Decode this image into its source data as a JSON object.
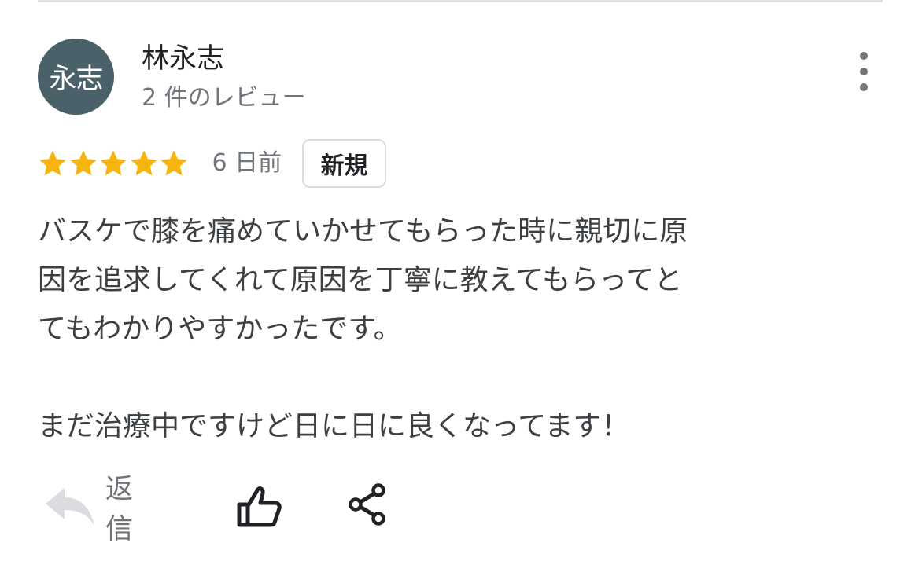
{
  "review": {
    "avatar_text": "永志",
    "reviewer_name": "林永志",
    "review_count": "2 件のレビュー",
    "rating": 5,
    "rating_max": 5,
    "age": "6 日前",
    "badge": "新規",
    "text": "バスケで膝を痛めていかせてもらった時に親切に原\n因を追求してくれて原因を丁寧に教えてもらってと\nてもわかりやすかったです。\n\nまだ治療中ですけど日に日に良くなってます！"
  },
  "actions": {
    "reply_label": "返信"
  },
  "icons": {
    "more": "more-vertical-icon",
    "star": "star-icon",
    "reply": "reply-arrow-icon",
    "like": "thumbs-up-icon",
    "share": "share-icon"
  },
  "colors": {
    "avatar_bg": "#4a6169",
    "star": "#f5b50e",
    "secondary_text": "#70757a",
    "primary_text": "#202124",
    "body_text": "#3c4043",
    "badge_border": "#dadce0",
    "divider": "#e3e3e3"
  }
}
